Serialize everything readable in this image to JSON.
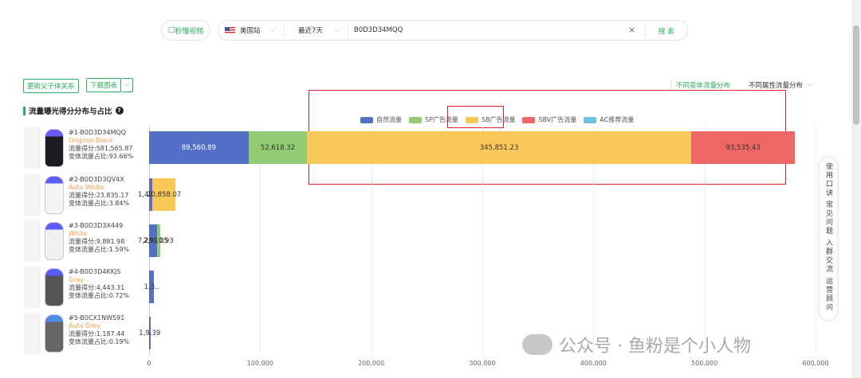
{
  "search": {
    "video_btn": "秒懂视频",
    "site": "美国站",
    "period": "最近7天",
    "query": "B0D3D34MQQ",
    "search_btn": "搜 索"
  },
  "toolbar": {
    "update_btn": "更新父子体关系",
    "download_btn": "下载图表",
    "tab_variant": "不同变体流量分布",
    "tab_attr": "不同属性流量分布"
  },
  "section_title": "流量曝光得分分布与占比",
  "products": [
    {
      "id": "#1-B0D3D34MQQ",
      "variant": "Original Black",
      "score": "流量得分:581,565.87",
      "share": "变体流量占比:93.66%"
    },
    {
      "id": "#2-B0D3D3QV4X",
      "variant": "Auto White",
      "score": "流量得分:23,835.17",
      "share": "变体流量占比:3.84%"
    },
    {
      "id": "#3-B0D3D3X449",
      "variant": "White",
      "score": "流量得分:9,881.98",
      "share": "变体流量占比:1.59%"
    },
    {
      "id": "#4-B0D3D4KKJS",
      "variant": "Gray",
      "score": "流量得分:4,443.31",
      "share": "变体流量占比:0.72%"
    },
    {
      "id": "#5-B0CX1NWS91",
      "variant": "Auto Grey",
      "score": "流量得分:1,187.44",
      "share": "变体流量占比:0.19%"
    }
  ],
  "chart_data": {
    "type": "bar",
    "orientation": "horizontal",
    "stacked": true,
    "categories": [
      "#1-B0D3D34MQQ",
      "#2-B0D3D3QV4X",
      "#3-B0D3D3X449",
      "#4-B0D3D4KKJS",
      "#5-B0CX1NWS91"
    ],
    "series": [
      {
        "name": "自然流量",
        "color": "#5470c6",
        "values": [
          89560.89,
          2977.1,
          6971.05,
          4443.31,
          1187.44
        ],
        "labels": [
          "89,560.89",
          "1,403.6",
          "7,291.05",
          "1,3..",
          "1,9.39"
        ]
      },
      {
        "name": "SP广告流量",
        "color": "#91cc75",
        "values": [
          52618.32,
          0,
          2910.93,
          0,
          0
        ],
        "labels": [
          "52,618.32",
          "",
          "2,910.93",
          "",
          ""
        ]
      },
      {
        "name": "SB广告流量",
        "color": "#fac858",
        "values": [
          345851.23,
          20858.07,
          0,
          0,
          0
        ],
        "labels": [
          "345,851.23",
          "20,858.07",
          "",
          "",
          ""
        ]
      },
      {
        "name": "SBV广告流量",
        "color": "#ee6666",
        "values": [
          93535.43,
          0,
          0,
          0,
          0
        ],
        "labels": [
          "93,535.43",
          "",
          "",
          "",
          ""
        ]
      },
      {
        "name": "AC推荐流量",
        "color": "#73c0de",
        "values": [
          0,
          0,
          0,
          0,
          0
        ],
        "labels": [
          "",
          "",
          "",
          "",
          ""
        ]
      }
    ],
    "xlim": [
      0,
      600000
    ],
    "xticks": [
      "0",
      "100,000",
      "200,000",
      "300,000",
      "400,000",
      "500,000",
      "600,000"
    ],
    "legend": "top-center"
  },
  "sidebar": {
    "items": [
      "使用口诀",
      "常见问题",
      "入群交流",
      "运营顾问"
    ]
  },
  "watermark": "公众号 · 鱼粉是个小人物"
}
